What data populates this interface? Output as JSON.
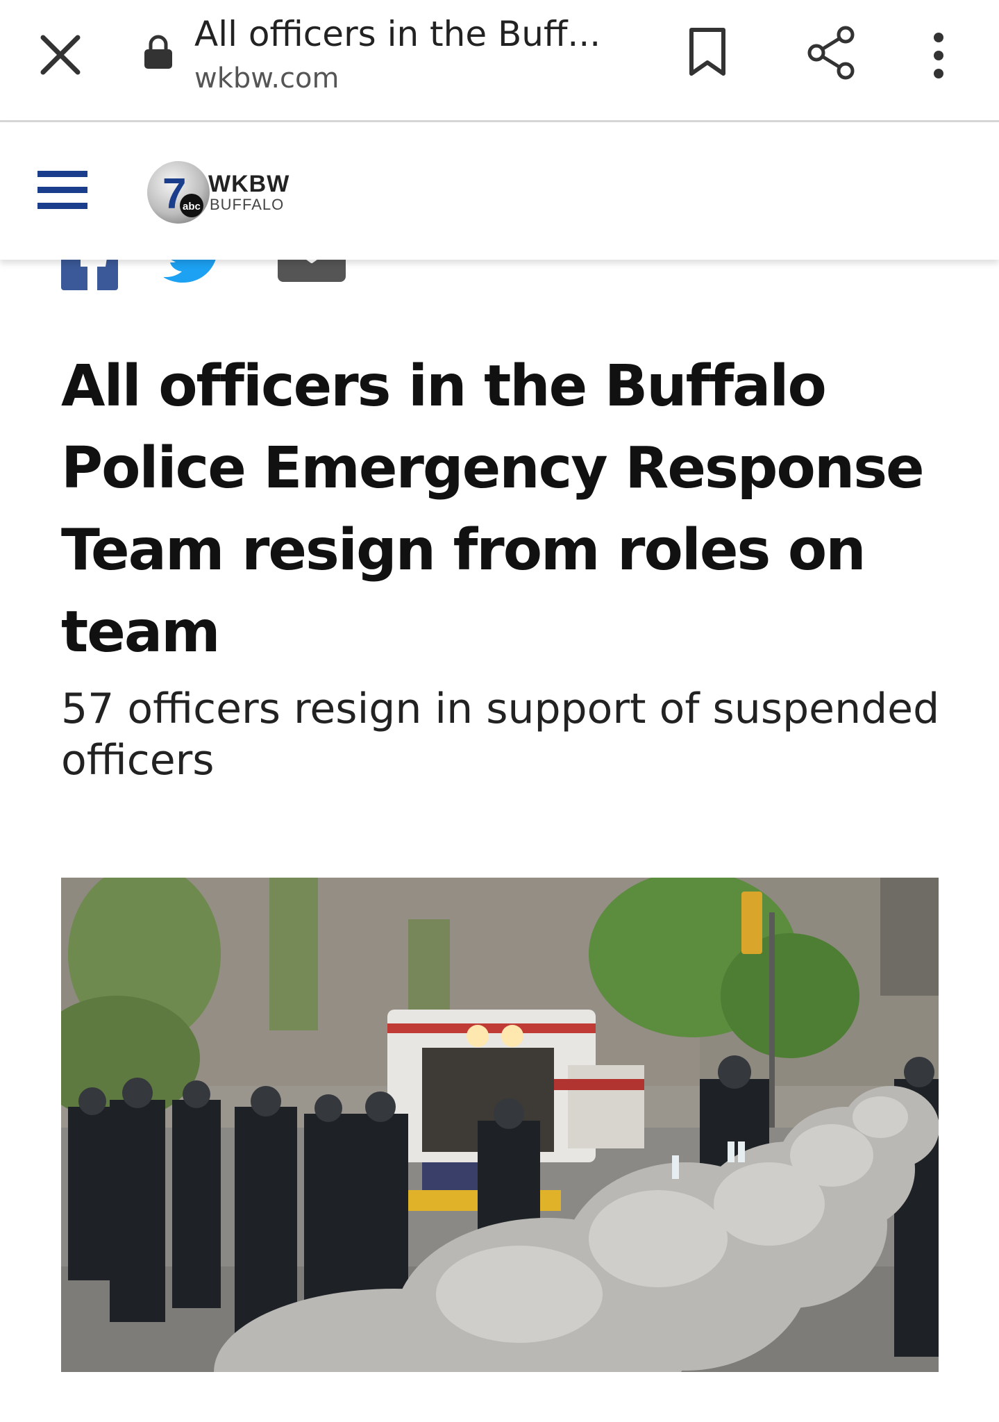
{
  "browser": {
    "tab_title": "All officers in the Buff...",
    "url": "wkbw.com"
  },
  "site": {
    "logo_name": "WKBW",
    "logo_city": "BUFFALO",
    "logo_badge": "abc",
    "logo_number": "7"
  },
  "article": {
    "headline": "All officers in the Buffalo Police Emergency Response Team resign from roles on team",
    "subhead": "57 officers resign in support of suspended officers"
  },
  "colors": {
    "brand_blue": "#1a3e8c",
    "facebook": "#3b5998",
    "twitter": "#1da1f2"
  },
  "icons": [
    "close-icon",
    "lock-icon",
    "bookmark-icon",
    "share-icon",
    "more-vert-icon",
    "hamburger-menu-icon",
    "facebook-icon",
    "twitter-icon",
    "email-icon"
  ]
}
